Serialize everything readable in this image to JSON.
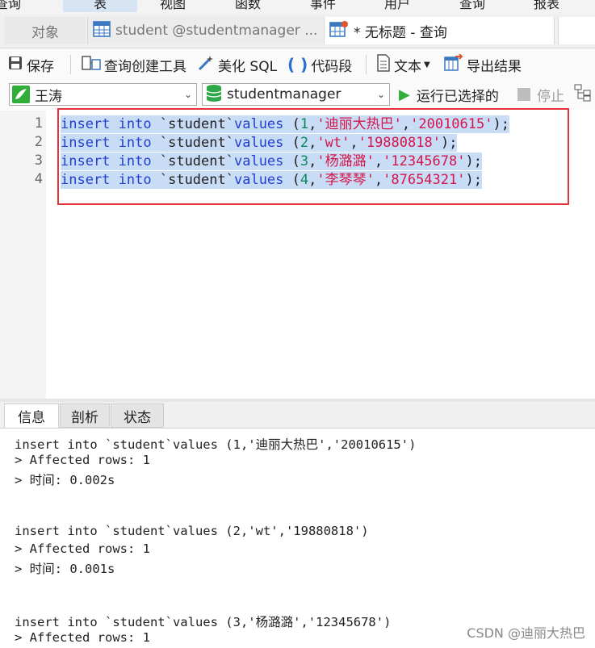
{
  "menubar": {
    "items": [
      "查询",
      "表",
      "视图",
      "函数",
      "事件",
      "用户",
      "查询",
      "报表"
    ]
  },
  "tabs": {
    "objects": "对象",
    "student": "student @studentmanager ...",
    "query": "* 无标题 - 查询"
  },
  "toolbar": {
    "save": "保存",
    "query_builder": "查询创建工具",
    "beautify_sql": "美化 SQL",
    "code_snippet": "代码段",
    "text": "文本",
    "export": "导出结果"
  },
  "selectors": {
    "connection": "王涛",
    "database": "studentmanager",
    "run_selected": "运行已选择的",
    "stop": "停止"
  },
  "editor": {
    "lines": [
      {
        "no": "1",
        "kw1": "insert",
        "kw2": "into",
        "tbl": " `student`",
        "kw3": "values",
        "open": " (",
        "num": "1",
        "c1": ",",
        "s1": "'迪丽大热巴'",
        "c2": ",",
        "s2": "'20010615'",
        "close": ");"
      },
      {
        "no": "2",
        "kw1": "insert",
        "kw2": "into",
        "tbl": " `student`",
        "kw3": "values",
        "open": " (",
        "num": "2",
        "c1": ",",
        "s1": "'wt'",
        "c2": ",",
        "s2": "'19880818'",
        "close": ");"
      },
      {
        "no": "3",
        "kw1": "insert",
        "kw2": "into",
        "tbl": " `student`",
        "kw3": "values",
        "open": " (",
        "num": "3",
        "c1": ",",
        "s1": "'杨潞潞'",
        "c2": ",",
        "s2": "'12345678'",
        "close": ");"
      },
      {
        "no": "4",
        "kw1": "insert",
        "kw2": "into",
        "tbl": " `student`",
        "kw3": "values",
        "open": " (",
        "num": "4",
        "c1": ",",
        "s1": "'李琴琴'",
        "c2": ",",
        "s2": "'87654321'",
        "close": ");"
      }
    ]
  },
  "output_tabs": {
    "info": "信息",
    "analyze": "剖析",
    "status": "状态"
  },
  "output": {
    "lines": [
      "insert into `student`values (1,'迪丽大热巴','20010615')",
      "> Affected rows: 1",
      "> 时间: 0.002s",
      "insert into `student`values (2,'wt','19880818')",
      "> Affected rows: 1",
      "> 时间: 0.001s",
      "insert into `student`values (3,'杨潞潞','12345678')",
      "> Affected rows: 1"
    ]
  },
  "watermark": "CSDN @迪丽大热巴",
  "colors": {
    "keyword": "#1f3fd1",
    "number": "#09885a",
    "string": "#d4154a",
    "selection": "#c9dcf6",
    "highlight_box": "#e3343a"
  }
}
